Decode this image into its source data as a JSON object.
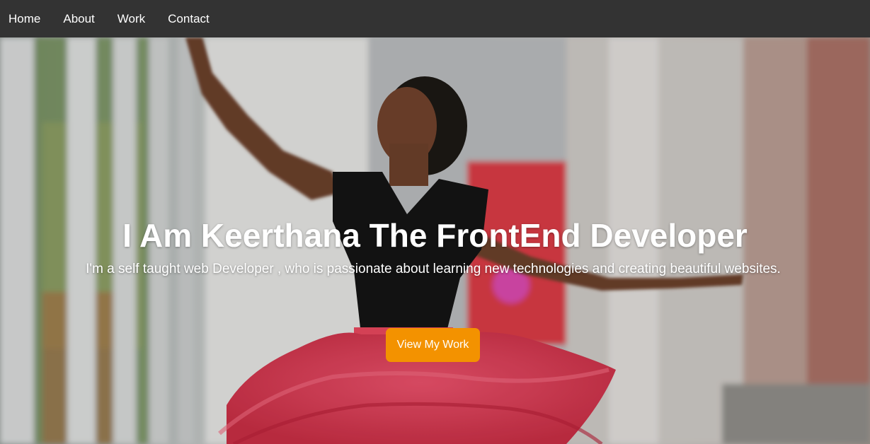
{
  "nav": {
    "items": [
      {
        "label": "Home"
      },
      {
        "label": "About"
      },
      {
        "label": "Work"
      },
      {
        "label": "Contact"
      }
    ]
  },
  "hero": {
    "title": "I Am Keerthana The FrontEnd Developer",
    "subtitle": "I'm a self taught web Developer , who is passionate about learning new technologies and creating beautiful websites.",
    "cta_label": "View My Work",
    "background_image": "ballerina-in-red-tutu-photo"
  },
  "colors": {
    "nav_bg": "#333333",
    "accent": "#f39200",
    "text": "#ffffff"
  }
}
